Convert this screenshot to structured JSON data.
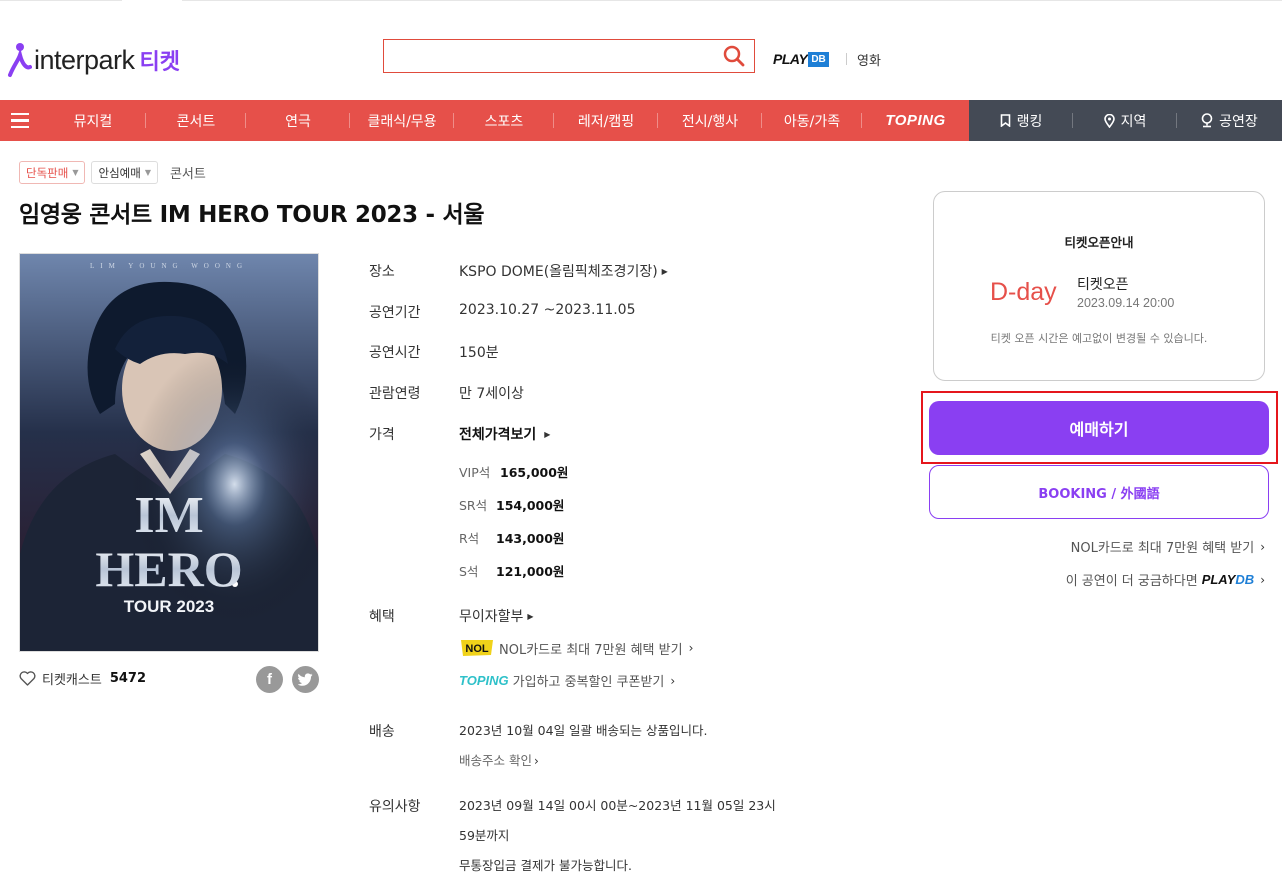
{
  "header": {
    "logo_text": "interpark",
    "logo_ticket": "티켓",
    "search_value": "",
    "playdb_play": "PLAY",
    "playdb_db": "DB",
    "movie_link": "영화"
  },
  "nav": {
    "items": [
      "뮤지컬",
      "콘서트",
      "연극",
      "클래식/무용",
      "스포츠",
      "레저/캠핑",
      "전시/행사",
      "아동/가족",
      "TOPING"
    ],
    "right_items": [
      "랭킹",
      "지역",
      "공연장"
    ],
    "colors": {
      "red": "#e6504a",
      "dark": "#444a55",
      "accent": "#8a3ff2"
    }
  },
  "tags": {
    "exclusive": "단독판매",
    "safe": "안심예매",
    "category": "콘서트"
  },
  "title": "임영웅 콘서트 IM HERO TOUR 2023 - 서울",
  "poster": {
    "top_text": "LIM YOUNG WOONG",
    "line1": "IM",
    "line2": "HERO",
    "line3": "TOUR 2023"
  },
  "cast": {
    "label": "티켓캐스트",
    "count": "5472"
  },
  "info": {
    "venue_label": "장소",
    "venue_value": "KSPO DOME(올림픽체조경기장)",
    "period_label": "공연기간",
    "period_value": "2023.10.27 ~2023.11.05",
    "runtime_label": "공연시간",
    "runtime_value": "150분",
    "age_label": "관람연령",
    "age_value": "만 7세이상",
    "price_label": "가격",
    "price_all": "전체가격보기",
    "prices": [
      {
        "grade": "VIP석",
        "amount": "165,000원"
      },
      {
        "grade": "SR석",
        "amount": "154,000원"
      },
      {
        "grade": "R석",
        "amount": "143,000원"
      },
      {
        "grade": "S석",
        "amount": "121,000원"
      }
    ],
    "benefit_label": "혜택",
    "benefit_value": "무이자할부",
    "benefit_nol_logo": "NOL",
    "benefit_nol": "NOL카드로 최대 7만원 혜택 받기",
    "benefit_toping_logo": "TOPING",
    "benefit_toping": "가입하고 중복할인 쿠폰받기",
    "delivery_label": "배송",
    "delivery_value": "2023년 10월 04일 일괄 배송되는 상품입니다.",
    "delivery_check": "배송주소 확인",
    "notice_label": "유의사항",
    "notice_line1": "2023년 09월 14일 00시 00분~2023년 11월 05일 23시",
    "notice_line2": "59분까지",
    "notice_line3": "무통장입금 결제가 불가능합니다."
  },
  "open": {
    "heading": "티켓오픈안내",
    "dday": "D-day",
    "open_label": "티켓오픈",
    "open_date": "2023.09.14 20:00",
    "note": "티켓 오픈 시간은 예고없이 변경될 수 있습니다."
  },
  "buttons": {
    "book": "예매하기",
    "foreign": "BOOKING / 外國語"
  },
  "links": {
    "nol": "NOL카드로 최대 7만원 혜택 받기",
    "curious": "이 공연이 더 궁금하다면",
    "playdb_play": "PLAY",
    "playdb_db": "DB"
  }
}
